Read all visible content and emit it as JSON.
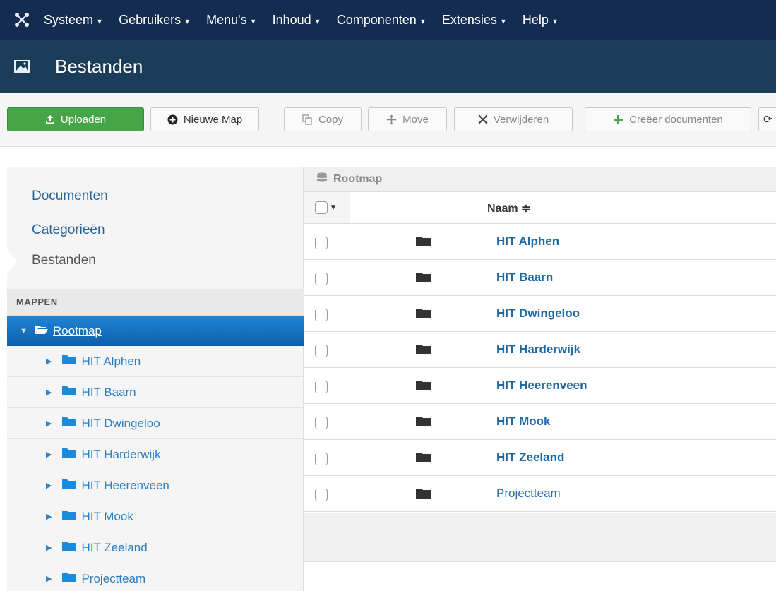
{
  "topnav": {
    "logo_icon": "joomla-logo-icon",
    "items": [
      {
        "label": "Systeem"
      },
      {
        "label": "Gebruikers"
      },
      {
        "label": "Menu's"
      },
      {
        "label": "Inhoud"
      },
      {
        "label": "Componenten"
      },
      {
        "label": "Extensies"
      },
      {
        "label": "Help"
      }
    ]
  },
  "header": {
    "icon": "image-icon",
    "title": "Bestanden"
  },
  "toolbar": {
    "upload": "Uploaden",
    "new_folder": "Nieuwe Map",
    "copy": "Copy",
    "move": "Move",
    "delete": "Verwijderen",
    "create_documents": "Creëer documenten"
  },
  "sidebar": {
    "links": [
      {
        "label": "Documenten"
      },
      {
        "label": "Categorieën"
      },
      {
        "label": "Bestanden"
      }
    ],
    "section_title": "MAPPEN",
    "root_label": "Rootmap",
    "folders": [
      {
        "label": "HIT Alphen"
      },
      {
        "label": "HIT Baarn"
      },
      {
        "label": "HIT Dwingeloo"
      },
      {
        "label": "HIT Harderwijk"
      },
      {
        "label": "HIT Heerenveen"
      },
      {
        "label": "HIT Mook"
      },
      {
        "label": "HIT Zeeland"
      },
      {
        "label": "Projectteam"
      }
    ]
  },
  "main": {
    "breadcrumb": "Rootmap",
    "column_name": "Naam ≑",
    "rows": [
      {
        "name": "HIT Alphen"
      },
      {
        "name": "HIT Baarn"
      },
      {
        "name": "HIT Dwingeloo"
      },
      {
        "name": "HIT Harderwijk"
      },
      {
        "name": "HIT Heerenveen"
      },
      {
        "name": "HIT Mook"
      },
      {
        "name": "HIT Zeeland"
      },
      {
        "name": "Projectteam"
      }
    ]
  },
  "colors": {
    "topnav_bg": "#132c50",
    "titlebar_bg": "#1c3d5a",
    "success": "#46a546",
    "link": "#2a7fc4",
    "tree_active": "#1e86d6"
  }
}
